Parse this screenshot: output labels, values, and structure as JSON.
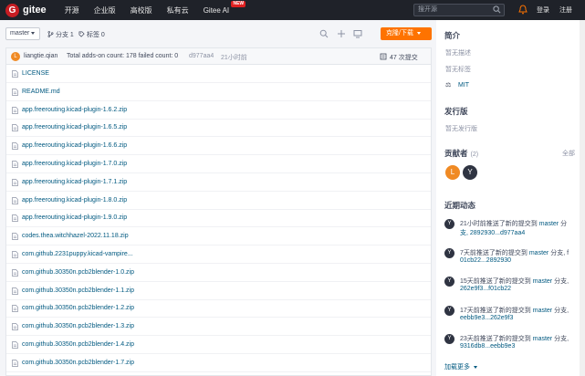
{
  "nav": {
    "logo_text": "gitee",
    "items": [
      "开源",
      "企业版",
      "高校版",
      "私有云",
      "Gitee AI"
    ],
    "new_badge": "NEW",
    "search_placeholder": "搜开源",
    "login": "登录",
    "register": "注册"
  },
  "toolbar": {
    "branch": "master",
    "branch_count": "分支 1",
    "tag_count": "标签 0",
    "clone_label": "克隆/下载"
  },
  "commit": {
    "avatar_letter": "L",
    "author": "liangtie.qian",
    "message": "Total adds-on count: 178 failed count: 0",
    "hash": "d977aa4",
    "time": "21小时前",
    "count": "47 次提交"
  },
  "files": [
    {
      "name": "LICENSE",
      "type": "file"
    },
    {
      "name": "README.md",
      "type": "file"
    },
    {
      "name": "app.freerouting.kicad-plugin-1.6.2.zip",
      "type": "file"
    },
    {
      "name": "app.freerouting.kicad-plugin-1.6.5.zip",
      "type": "file"
    },
    {
      "name": "app.freerouting.kicad-plugin-1.6.6.zip",
      "type": "file"
    },
    {
      "name": "app.freerouting.kicad-plugin-1.7.0.zip",
      "type": "file"
    },
    {
      "name": "app.freerouting.kicad-plugin-1.7.1.zip",
      "type": "file"
    },
    {
      "name": "app.freerouting.kicad-plugin-1.8.0.zip",
      "type": "file"
    },
    {
      "name": "app.freerouting.kicad-plugin-1.9.0.zip",
      "type": "file"
    },
    {
      "name": "codes.thea.witchhazel-2022.11.18.zip",
      "type": "file"
    },
    {
      "name": "com.github.2231puppy.kicad-vampire...",
      "type": "file"
    },
    {
      "name": "com.github.30350n.pcb2blender-1.0.zip",
      "type": "file"
    },
    {
      "name": "com.github.30350n.pcb2blender-1.1.zip",
      "type": "file"
    },
    {
      "name": "com.github.30350n.pcb2blender-1.2.zip",
      "type": "file"
    },
    {
      "name": "com.github.30350n.pcb2blender-1.3.zip",
      "type": "file"
    },
    {
      "name": "com.github.30350n.pcb2blender-1.4.zip",
      "type": "file"
    },
    {
      "name": "com.github.30350n.pcb2blender-1.7.zip",
      "type": "file"
    }
  ],
  "sidebar": {
    "intro_title": "简介",
    "no_desc": "暂无描述",
    "no_tags": "暂无标签",
    "license": "MIT",
    "release_title": "发行版",
    "no_release": "暂无发行版",
    "contrib_title": "贡献者",
    "contrib_count": "(2)",
    "all": "全部",
    "contributors": [
      {
        "letter": "L",
        "color": "#f08a24"
      },
      {
        "letter": "Y",
        "color": "#2f3442"
      }
    ],
    "activity_title": "近期动态",
    "activities": [
      {
        "l1a": "21小时前推送了新的提交到 ",
        "branch": "master",
        "l1b": " 分",
        "l2": "支, 2892930...d977aa4"
      },
      {
        "l1a": "7天前推送了新的提交到 ",
        "branch": "master",
        "l1b": " 分支, f",
        "l2": "01cb22...2892930"
      },
      {
        "l1a": "15天前推送了新的提交到 ",
        "branch": "master",
        "l1b": " 分支,",
        "l2": "262e9f3...f01cb22"
      },
      {
        "l1a": "17天前推送了新的提交到 ",
        "branch": "master",
        "l1b": " 分支,",
        "l2": "eebb9e3...262e9f3"
      },
      {
        "l1a": "23天前推送了新的提交到 ",
        "branch": "master",
        "l1b": " 分支,",
        "l2": "9316db8...eebb9e3"
      }
    ],
    "load_more": "加载更多"
  }
}
